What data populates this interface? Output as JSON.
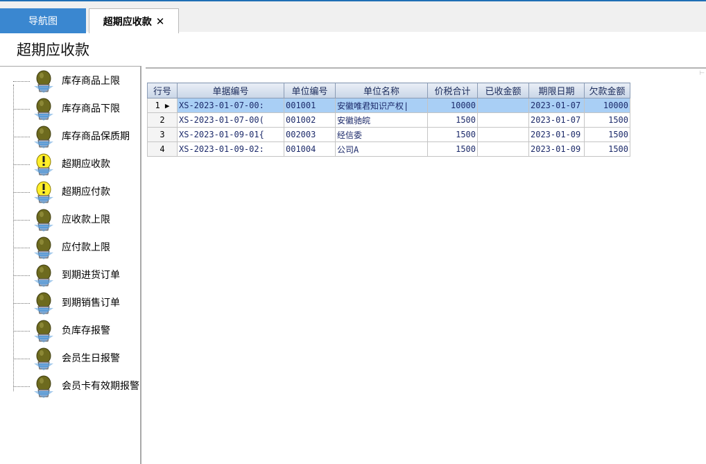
{
  "tabs": [
    {
      "label": "导航图"
    },
    {
      "label": "超期应收款",
      "close": "✕"
    }
  ],
  "page_title": "超期应收款",
  "tree": {
    "items": [
      {
        "label": "库存商品上限",
        "icon": "lightbulb-off-icon"
      },
      {
        "label": "库存商品下限",
        "icon": "lightbulb-off-icon"
      },
      {
        "label": "库存商品保质期",
        "icon": "lightbulb-off-icon"
      },
      {
        "label": "超期应收款",
        "icon": "lightbulb-alert-icon"
      },
      {
        "label": "超期应付款",
        "icon": "lightbulb-alert-icon"
      },
      {
        "label": "应收款上限",
        "icon": "lightbulb-off-icon"
      },
      {
        "label": "应付款上限",
        "icon": "lightbulb-off-icon"
      },
      {
        "label": "到期进货订单",
        "icon": "lightbulb-off-icon"
      },
      {
        "label": "到期销售订单",
        "icon": "lightbulb-off-icon"
      },
      {
        "label": "负库存报警",
        "icon": "lightbulb-off-icon"
      },
      {
        "label": "会员生日报警",
        "icon": "lightbulb-off-icon"
      },
      {
        "label": "会员卡有效期报警",
        "icon": "lightbulb-off-icon"
      }
    ]
  },
  "grid": {
    "columns": [
      "行号",
      "单据编号",
      "单位编号",
      "单位名称",
      "价税合计",
      "已收金额",
      "期限日期",
      "欠款金额"
    ],
    "rows": [
      {
        "row": "1",
        "code": "XS-2023-01-07-00:",
        "unit_no": "001001",
        "unit_name": "安徽唯君知识产权|",
        "total": "10000",
        "received": "",
        "due": "2023-01-07",
        "owed": "10000",
        "selected": true
      },
      {
        "row": "2",
        "code": "XS-2023-01-07-00(",
        "unit_no": "001002",
        "unit_name": "安徽驰皖",
        "total": "1500",
        "received": "",
        "due": "2023-01-07",
        "owed": "1500"
      },
      {
        "row": "3",
        "code": "XS-2023-01-09-01{",
        "unit_no": "002003",
        "unit_name": "经信委",
        "total": "1500",
        "received": "",
        "due": "2023-01-09",
        "owed": "1500"
      },
      {
        "row": "4",
        "code": "XS-2023-01-09-02:",
        "unit_no": "001004",
        "unit_name": "公司A",
        "total": "1500",
        "received": "",
        "due": "2023-01-09",
        "owed": "1500"
      }
    ],
    "current_row_marker": "▶"
  },
  "colors": {
    "accent": "#3a87d0",
    "selected_row": "#a9cff5",
    "header_text": "#1a2a5a"
  }
}
